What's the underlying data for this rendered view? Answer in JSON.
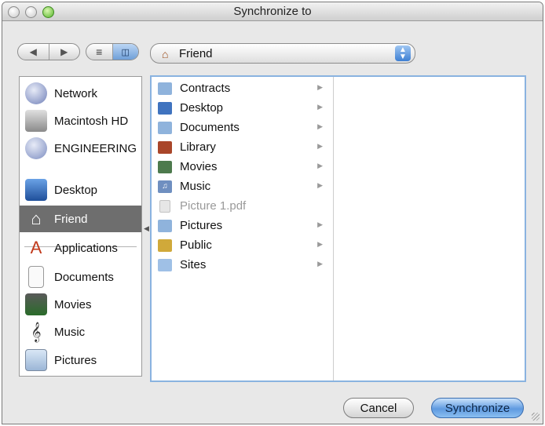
{
  "window": {
    "title": "Synchronize to"
  },
  "toolbar": {
    "back_icon": "back-arrow-icon",
    "forward_icon": "forward-arrow-icon",
    "view_list_icon": "list-view-icon",
    "view_column_icon": "column-view-icon",
    "location": "Friend"
  },
  "sidebar": {
    "items": [
      {
        "label": "Network",
        "icon": "network-globe-icon",
        "selected": false
      },
      {
        "label": "Macintosh HD",
        "icon": "hard-drive-icon",
        "selected": false
      },
      {
        "label": "ENGINEERING",
        "icon": "network-volume-icon",
        "selected": false
      },
      {
        "label": "Desktop",
        "icon": "desktop-icon",
        "selected": false
      },
      {
        "label": "Friend",
        "icon": "home-icon",
        "selected": true
      },
      {
        "label": "Applications",
        "icon": "applications-icon",
        "selected": false
      },
      {
        "label": "Documents",
        "icon": "documents-icon",
        "selected": false
      },
      {
        "label": "Movies",
        "icon": "movies-icon",
        "selected": false
      },
      {
        "label": "Music",
        "icon": "music-icon",
        "selected": false
      },
      {
        "label": "Pictures",
        "icon": "pictures-icon",
        "selected": false
      }
    ]
  },
  "browser": {
    "column1": [
      {
        "label": "Contracts",
        "icon": "folder-icon",
        "has_children": true,
        "disabled": false
      },
      {
        "label": "Desktop",
        "icon": "desktop-folder-icon",
        "has_children": true,
        "disabled": false
      },
      {
        "label": "Documents",
        "icon": "documents-folder-icon",
        "has_children": true,
        "disabled": false
      },
      {
        "label": "Library",
        "icon": "library-folder-icon",
        "has_children": true,
        "disabled": false
      },
      {
        "label": "Movies",
        "icon": "movies-folder-icon",
        "has_children": true,
        "disabled": false
      },
      {
        "label": "Music",
        "icon": "music-folder-icon",
        "has_children": true,
        "disabled": false
      },
      {
        "label": "Picture 1.pdf",
        "icon": "pdf-file-icon",
        "has_children": false,
        "disabled": true
      },
      {
        "label": "Pictures",
        "icon": "pictures-folder-icon",
        "has_children": true,
        "disabled": false
      },
      {
        "label": "Public",
        "icon": "public-folder-icon",
        "has_children": true,
        "disabled": false
      },
      {
        "label": "Sites",
        "icon": "sites-folder-icon",
        "has_children": true,
        "disabled": false
      }
    ]
  },
  "buttons": {
    "cancel": "Cancel",
    "synchronize": "Synchronize"
  },
  "colors": {
    "accent": "#5f9ae0",
    "sidebar_selected": "#6e6e6e",
    "focus_ring": "#8ab3e0"
  }
}
